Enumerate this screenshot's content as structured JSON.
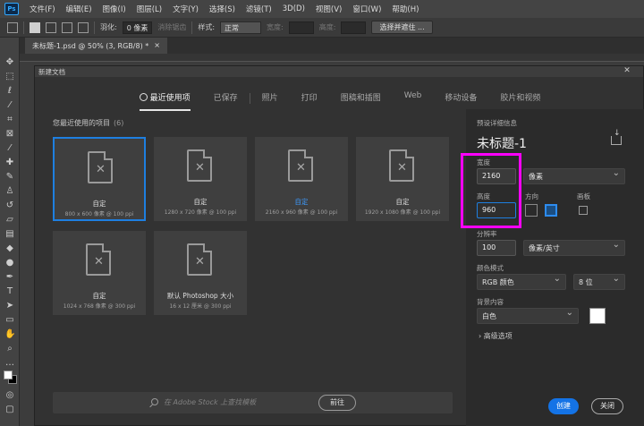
{
  "app": {
    "logo": "Ps",
    "menu": [
      "文件(F)",
      "编辑(E)",
      "图像(I)",
      "图层(L)",
      "文字(Y)",
      "选择(S)",
      "滤镜(T)",
      "3D(D)",
      "视图(V)",
      "窗口(W)",
      "帮助(H)"
    ]
  },
  "options_bar": {
    "feather_label": "羽化:",
    "feather_value": "0 像素",
    "antialias_label": "消除锯齿",
    "style_label": "样式:",
    "style_value": "正常",
    "width_label": "宽度:",
    "height_label": "高度:",
    "select_mask_button": "选择并遮住 ..."
  },
  "document_tab": {
    "title": "未标题-1.psd @ 50% (3, RGB/8) *",
    "close": "×"
  },
  "dialog": {
    "title": "新建文档",
    "close": "✕",
    "tabs": [
      "最近使用项",
      "已保存",
      "照片",
      "打印",
      "图稿和插图",
      "Web",
      "移动设备",
      "胶片和视频"
    ],
    "recent_label": "您最近使用的项目",
    "recent_count": "(6)",
    "recent_items": [
      {
        "name": "自定",
        "dims": "800 x 600 像素 @ 100 ppi"
      },
      {
        "name": "自定",
        "dims": "1280 x 720 像素 @ 100 ppi"
      },
      {
        "name": "自定",
        "dims": "2160 x 960 像素 @ 100 ppi"
      },
      {
        "name": "自定",
        "dims": "1920 x 1080 像素 @ 100 ppi"
      },
      {
        "name": "自定",
        "dims": "1024 x 768 像素 @ 300 ppi"
      },
      {
        "name": "默认 Photoshop 大小",
        "dims": "16 x 12 厘米 @ 300 ppi"
      }
    ],
    "search_placeholder": "在 Adobe Stock 上查找模板",
    "search_go": "前往",
    "preset": {
      "section_label": "预设详细信息",
      "name": "未标题-1",
      "width_label": "宽度",
      "width_value": "2160",
      "width_unit": "像素",
      "height_label": "高度",
      "height_value": "960",
      "orientation_label": "方向",
      "artboard_label": "画板",
      "resolution_label": "分辨率",
      "resolution_value": "100",
      "resolution_unit": "像素/英寸",
      "color_mode_label": "颜色模式",
      "color_mode_value": "RGB 颜色",
      "bit_depth_value": "8 位",
      "background_label": "背景内容",
      "background_value": "白色",
      "advanced_label": "高级选项"
    },
    "create_button": "创建",
    "close_button": "关闭"
  },
  "colors": {
    "accent": "#1473e6",
    "highlight": "#ff00ff",
    "selected_border": "#1e7fe0"
  }
}
